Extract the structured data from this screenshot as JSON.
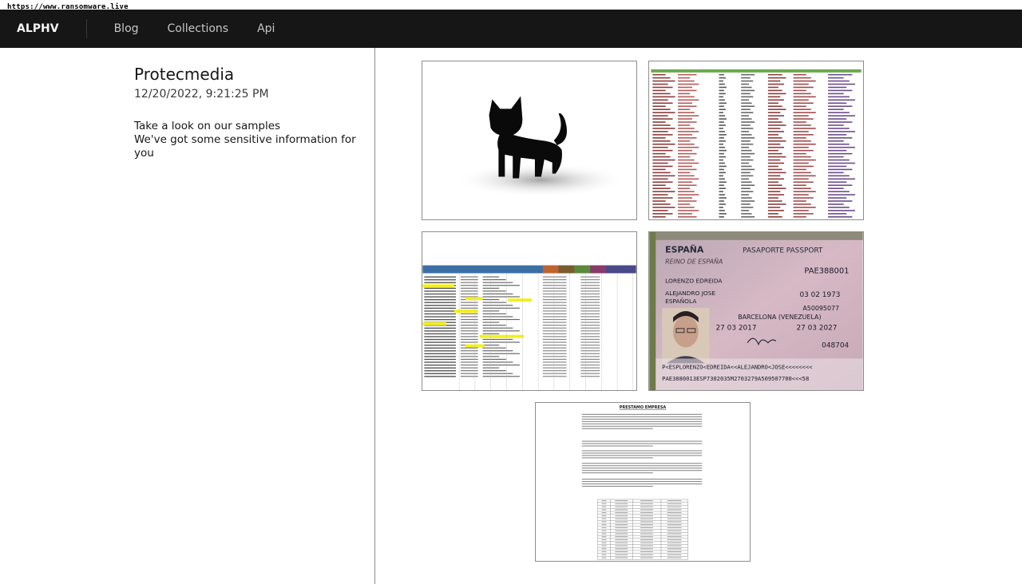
{
  "browser": {
    "url": "https://www.ransomware.live"
  },
  "nav": {
    "brand": "ALPHV",
    "items": [
      {
        "label": "Blog"
      },
      {
        "label": "Collections"
      },
      {
        "label": "Api"
      }
    ]
  },
  "post": {
    "title": "Protecmedia",
    "date": "12/20/2022, 9:21:25 PM",
    "lines": [
      "Take a look on our samples",
      "We've got some sensitive information for you"
    ]
  },
  "gallery": {
    "passport": {
      "country": "ESPAÑA",
      "doc_type": "PASAPORTE PASSPORT",
      "kingdom": "REINO DE ESPAÑA",
      "number": "PAE388001",
      "surname": "LORENZO EDREIDA",
      "given_names": "ALEJANDRO JOSE",
      "nationality": "ESPAÑOLA",
      "birth_date": "03 02 1973",
      "id_number": "A50095077",
      "birth_place": "BARCELONA (VENEZUELA)",
      "issue_date": "27 03 2017",
      "expiry_date": "27 03 2027",
      "mrz_line1": "P<ESPLORENZO<EDREIDA<<ALEJANDRO<JOSE<<<<<<<<",
      "mrz_line2": "PAE3880013ESP7302035M2703279A509507700<<<58"
    },
    "document": {
      "heading": "PRESTAMO EMPRESA"
    }
  }
}
